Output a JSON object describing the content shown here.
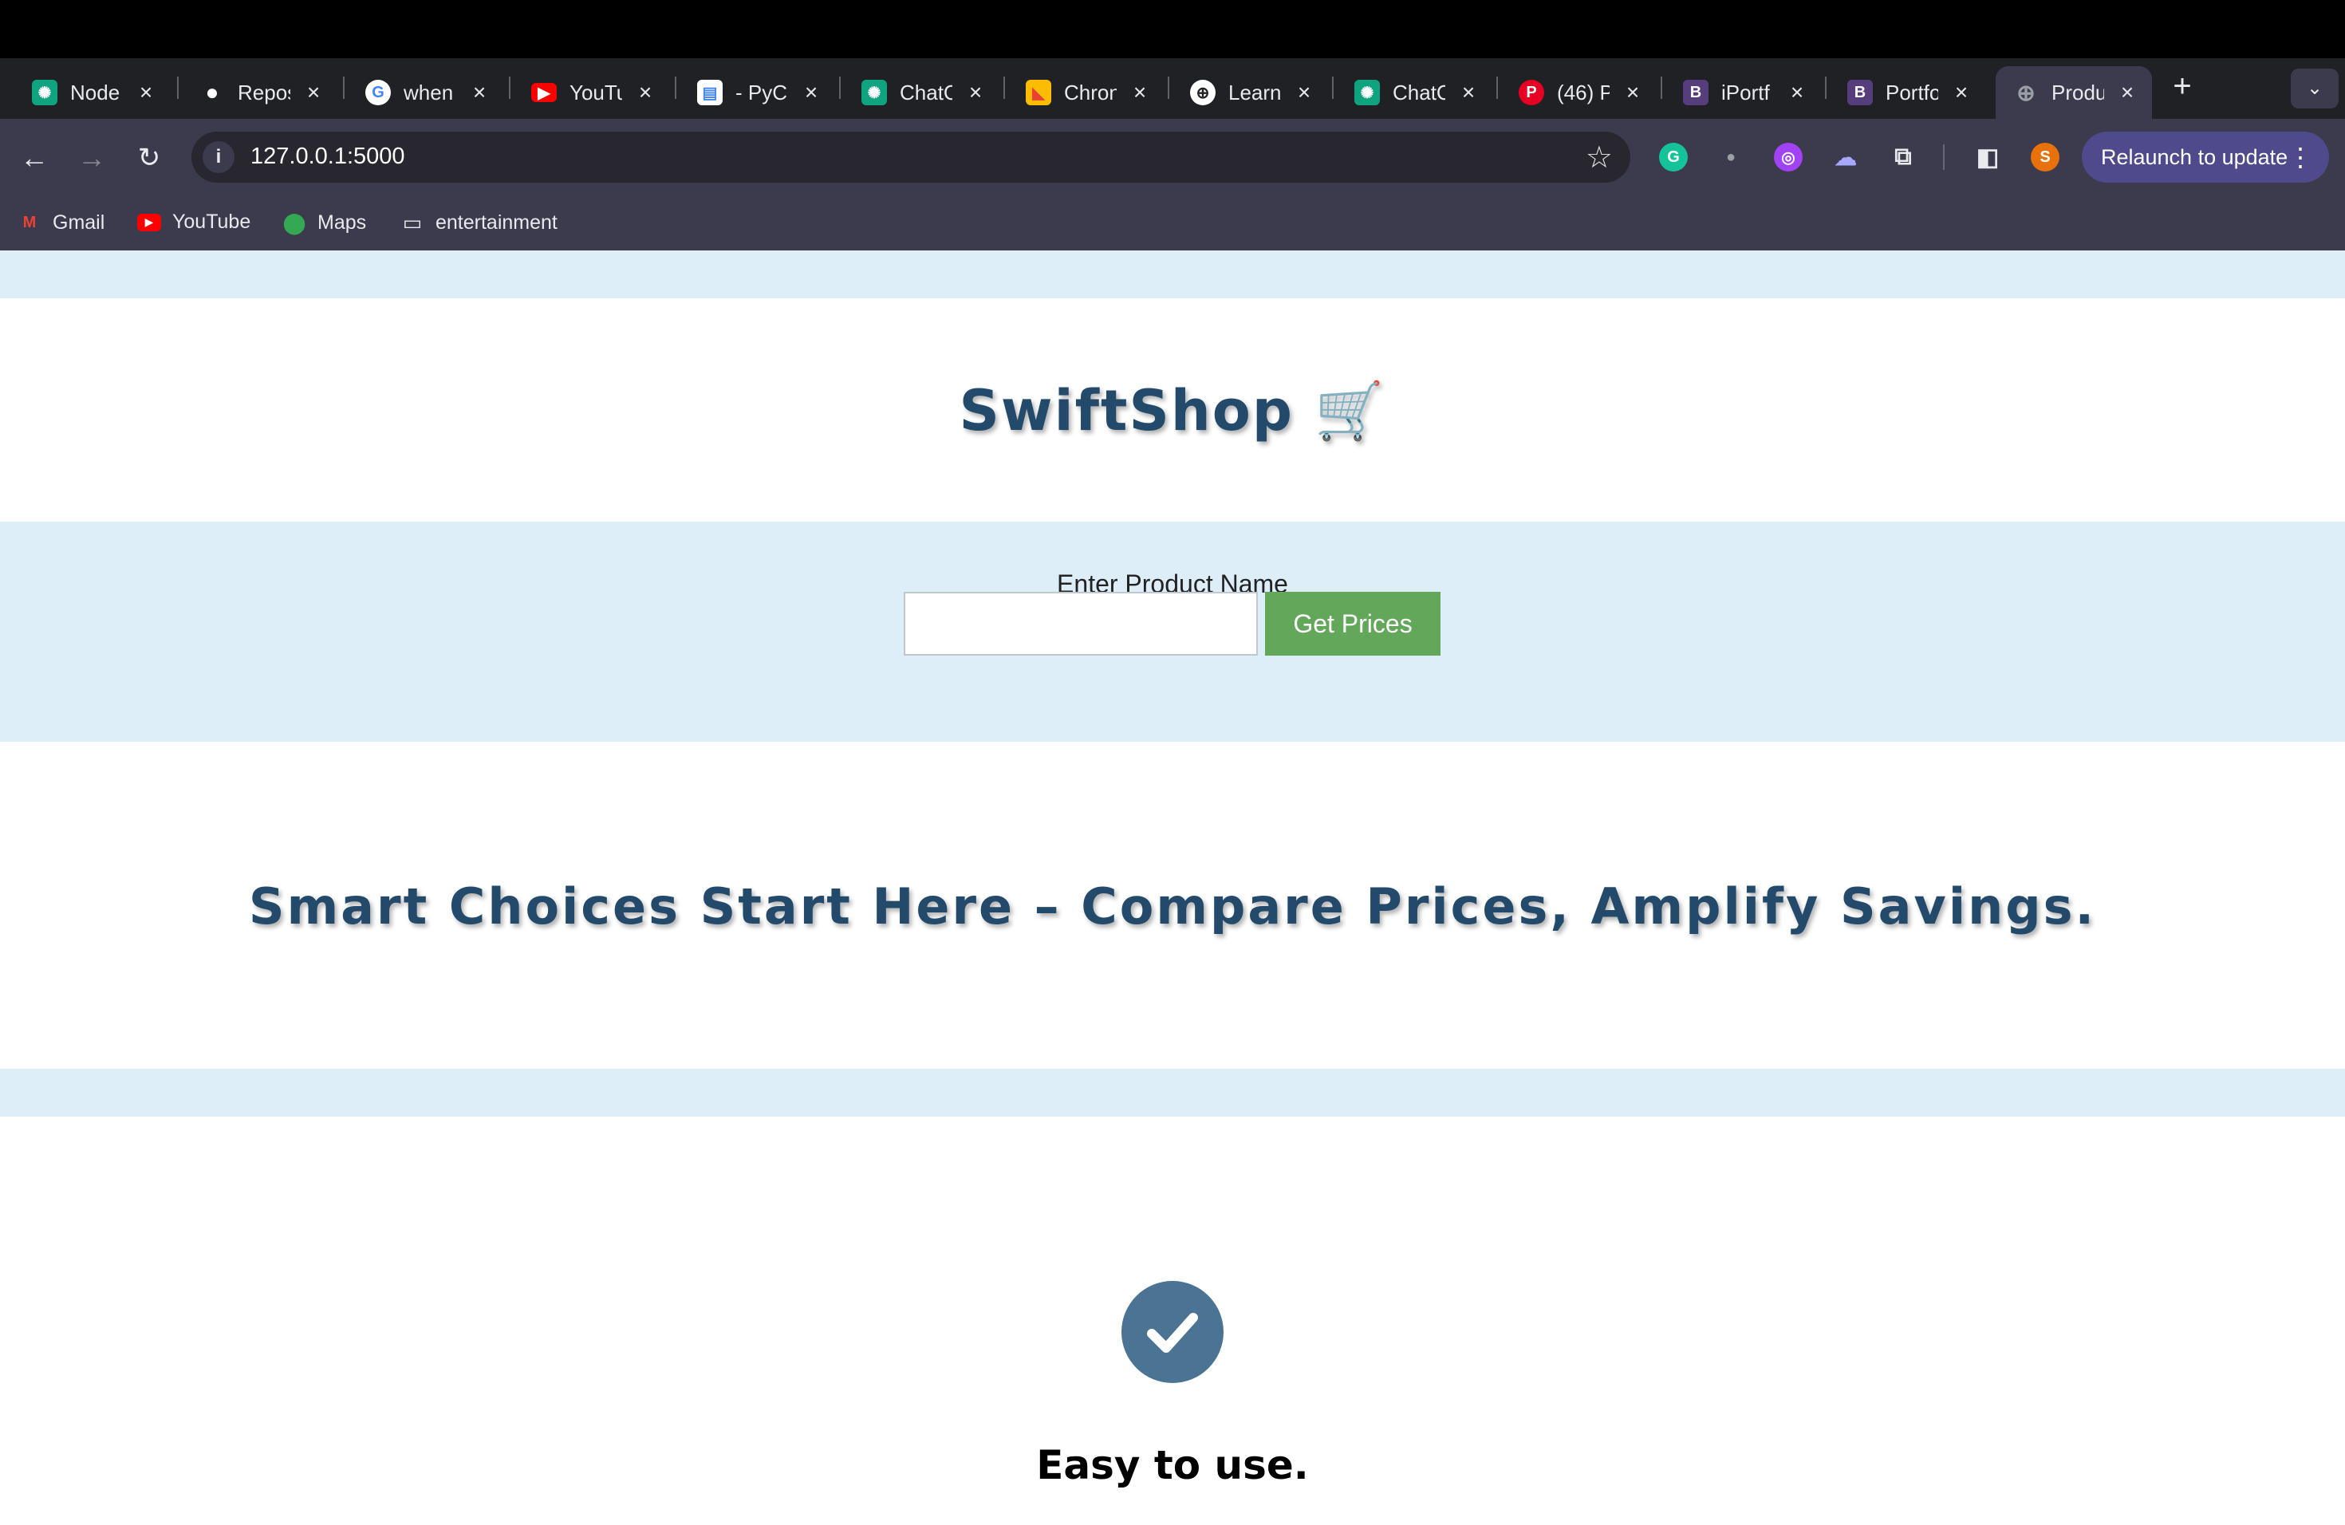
{
  "browser": {
    "tabs": [
      {
        "title": "Node",
        "icon": "chatgpt-icon",
        "color": "#10a37f"
      },
      {
        "title": "Repos",
        "icon": "github-icon",
        "color": "#ffffff"
      },
      {
        "title": "when",
        "icon": "google-icon",
        "color": "#4285f4"
      },
      {
        "title": "YouTu",
        "icon": "youtube-icon",
        "color": "#ff0000"
      },
      {
        "title": "- PyC",
        "icon": "doc-icon",
        "color": "#4285f4"
      },
      {
        "title": "ChatC",
        "icon": "chatgpt-icon",
        "color": "#10a37f"
      },
      {
        "title": "Chron",
        "icon": "chrome-flag-icon",
        "color": "#e94235"
      },
      {
        "title": "Learn",
        "icon": "globe-icon",
        "color": "#ffffff"
      },
      {
        "title": "ChatC",
        "icon": "chatgpt-icon",
        "color": "#10a37f"
      },
      {
        "title": "(46) P",
        "icon": "pinterest-icon",
        "color": "#e60023"
      },
      {
        "title": "iPortf",
        "icon": "bootstrap-icon",
        "color": "#563d7c"
      },
      {
        "title": "Portfo",
        "icon": "bootstrap-icon",
        "color": "#563d7c"
      },
      {
        "title": "Produ",
        "icon": "globe-icon",
        "color": "#9aa0a6"
      }
    ],
    "new_tab": "+",
    "url": "127.0.0.1:5000",
    "relaunch_label": "Relaunch to update",
    "profile_initial": "S",
    "bookmarks": [
      {
        "label": "Gmail",
        "icon": "gmail-icon"
      },
      {
        "label": "YouTube",
        "icon": "youtube-icon"
      },
      {
        "label": "Maps",
        "icon": "maps-icon"
      },
      {
        "label": "entertainment",
        "icon": "folder-icon"
      }
    ]
  },
  "page": {
    "brand": "SwiftShop 🛒",
    "search_label": "Enter Product Name",
    "search_value": "",
    "button_label": "Get Prices",
    "tagline": "Smart Choices Start Here – Compare Prices, Amplify Savings.",
    "feature_title": "Easy to use."
  },
  "colors": {
    "brand_text": "#244a6b",
    "band": "#ddeef9",
    "button": "#63a85a",
    "check_circle": "#4b7394"
  }
}
